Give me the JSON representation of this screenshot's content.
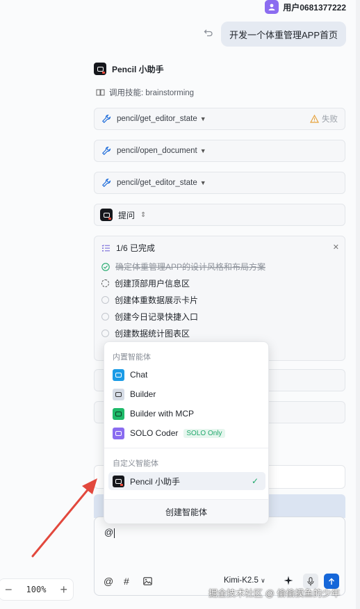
{
  "zoom": {
    "value": "100%",
    "minus": "−",
    "plus": "+"
  },
  "user": {
    "name": "用户0681377222"
  },
  "message": {
    "text": "开发一个体重管理APP首页"
  },
  "agent": {
    "name": "Pencil 小助手"
  },
  "skill": {
    "text": "调用技能: brainstorming"
  },
  "tools": [
    {
      "name": "pencil/get_editor_state",
      "status": "失败"
    },
    {
      "name": "pencil/open_document"
    },
    {
      "name": "pencil/get_editor_state"
    }
  ],
  "ask": {
    "label": "提问"
  },
  "todo": {
    "progress": "1/6 已完成",
    "items": [
      {
        "text": "确定体重管理APP的设计风格和布局方案",
        "state": "done"
      },
      {
        "text": "创建顶部用户信息区",
        "state": "in-progress"
      },
      {
        "text": "创建体重数据展示卡片",
        "state": "pending"
      },
      {
        "text": "创建今日记录快捷入口",
        "state": "pending"
      },
      {
        "text": "创建数据统计图表区",
        "state": "pending"
      }
    ]
  },
  "dropdown": {
    "builtin_label": "内置智能体",
    "builtin": [
      {
        "name": "Chat",
        "color": "#1a9be6"
      },
      {
        "name": "Builder",
        "color": "#d6dce6"
      },
      {
        "name": "Builder with MCP",
        "color": "#1fba6a"
      },
      {
        "name": "SOLO Coder",
        "color": "#8a6cf0",
        "badge": "SOLO Only"
      }
    ],
    "custom_label": "自定义智能体",
    "custom": [
      {
        "name": "Pencil 小助手",
        "selected": true
      }
    ],
    "create_label": "创建智能体"
  },
  "composer": {
    "text": "@",
    "model": "Kimi-K2.5"
  },
  "watermark": "掘金技术社区 @ 偷偷摸鱼的少年",
  "colors": {
    "accent": "#1667d9",
    "success": "#1fa86b",
    "warning": "#e6a23c"
  }
}
